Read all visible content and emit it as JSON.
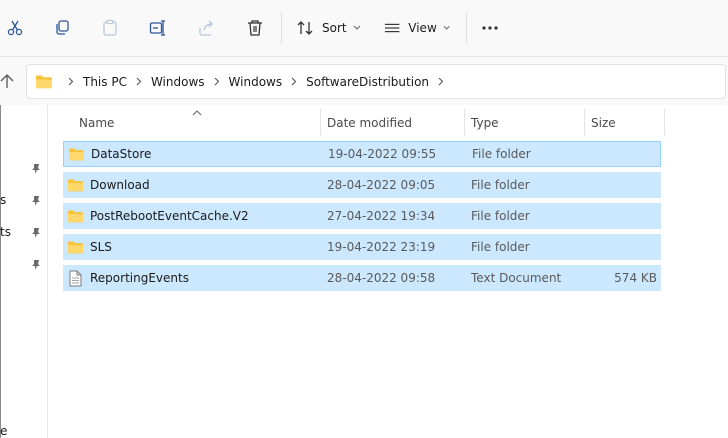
{
  "toolbar": {
    "sort_label": "Sort",
    "view_label": "View",
    "buttons": [
      "cut-icon",
      "copy-icon",
      "paste-icon",
      "rename-icon",
      "share-icon",
      "delete-icon",
      "sort-icon",
      "view-icon",
      "more-icon"
    ]
  },
  "address": {
    "crumbs": [
      "This PC",
      "Windows",
      "Windows",
      "SoftwareDistribution"
    ]
  },
  "nav": {
    "fragments": [
      "s",
      "ts",
      "e"
    ]
  },
  "columns": {
    "name": "Name",
    "date": "Date modified",
    "type": "Type",
    "size": "Size"
  },
  "files": [
    {
      "name": "DataStore",
      "date": "19-04-2022 09:55",
      "type": "File folder",
      "size": "",
      "icon": "folder-icon"
    },
    {
      "name": "Download",
      "date": "28-04-2022 09:05",
      "type": "File folder",
      "size": "",
      "icon": "folder-icon"
    },
    {
      "name": "PostRebootEventCache.V2",
      "date": "27-04-2022 19:34",
      "type": "File folder",
      "size": "",
      "icon": "folder-icon"
    },
    {
      "name": "SLS",
      "date": "19-04-2022 23:19",
      "type": "File folder",
      "size": "",
      "icon": "folder-icon"
    },
    {
      "name": "ReportingEvents",
      "date": "28-04-2022 09:58",
      "type": "Text Document",
      "size": "574 KB",
      "icon": "text-document-icon"
    }
  ],
  "colors": {
    "selection": "#cce8ff",
    "selection_border": "#99d1ff",
    "toolbar_bg": "#f9f9f9",
    "icon_blue": "#2b579a",
    "folder_yellow": "#f8c338"
  }
}
